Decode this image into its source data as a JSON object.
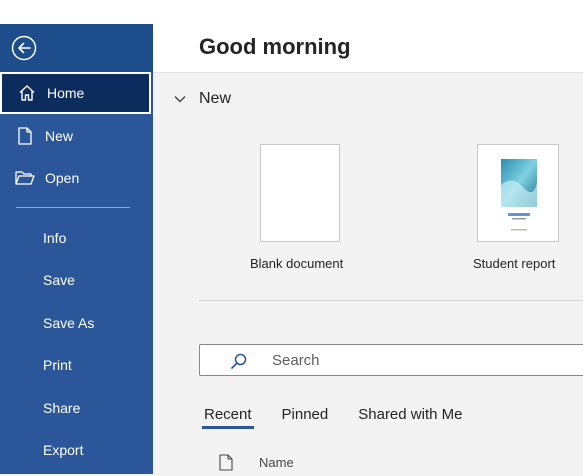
{
  "sidebar": {
    "items": [
      {
        "label": "Home",
        "icon": "home-icon"
      },
      {
        "label": "New",
        "icon": "new-document-icon"
      },
      {
        "label": "Open",
        "icon": "folder-open-icon"
      },
      {
        "label": "Info"
      },
      {
        "label": "Save"
      },
      {
        "label": "Save As"
      },
      {
        "label": "Print"
      },
      {
        "label": "Share"
      },
      {
        "label": "Export"
      }
    ],
    "accent": "#2b579a",
    "active_bg": "#0d2c5e"
  },
  "main": {
    "greeting": "Good morning",
    "new_section": {
      "title": "New",
      "templates": [
        {
          "label": "Blank document"
        },
        {
          "label": "Student report"
        }
      ]
    },
    "search": {
      "placeholder": "Search"
    },
    "tabs": [
      {
        "label": "Recent",
        "active": true
      },
      {
        "label": "Pinned",
        "active": false
      },
      {
        "label": "Shared with Me",
        "active": false
      }
    ],
    "columns": {
      "name": "Name"
    }
  }
}
